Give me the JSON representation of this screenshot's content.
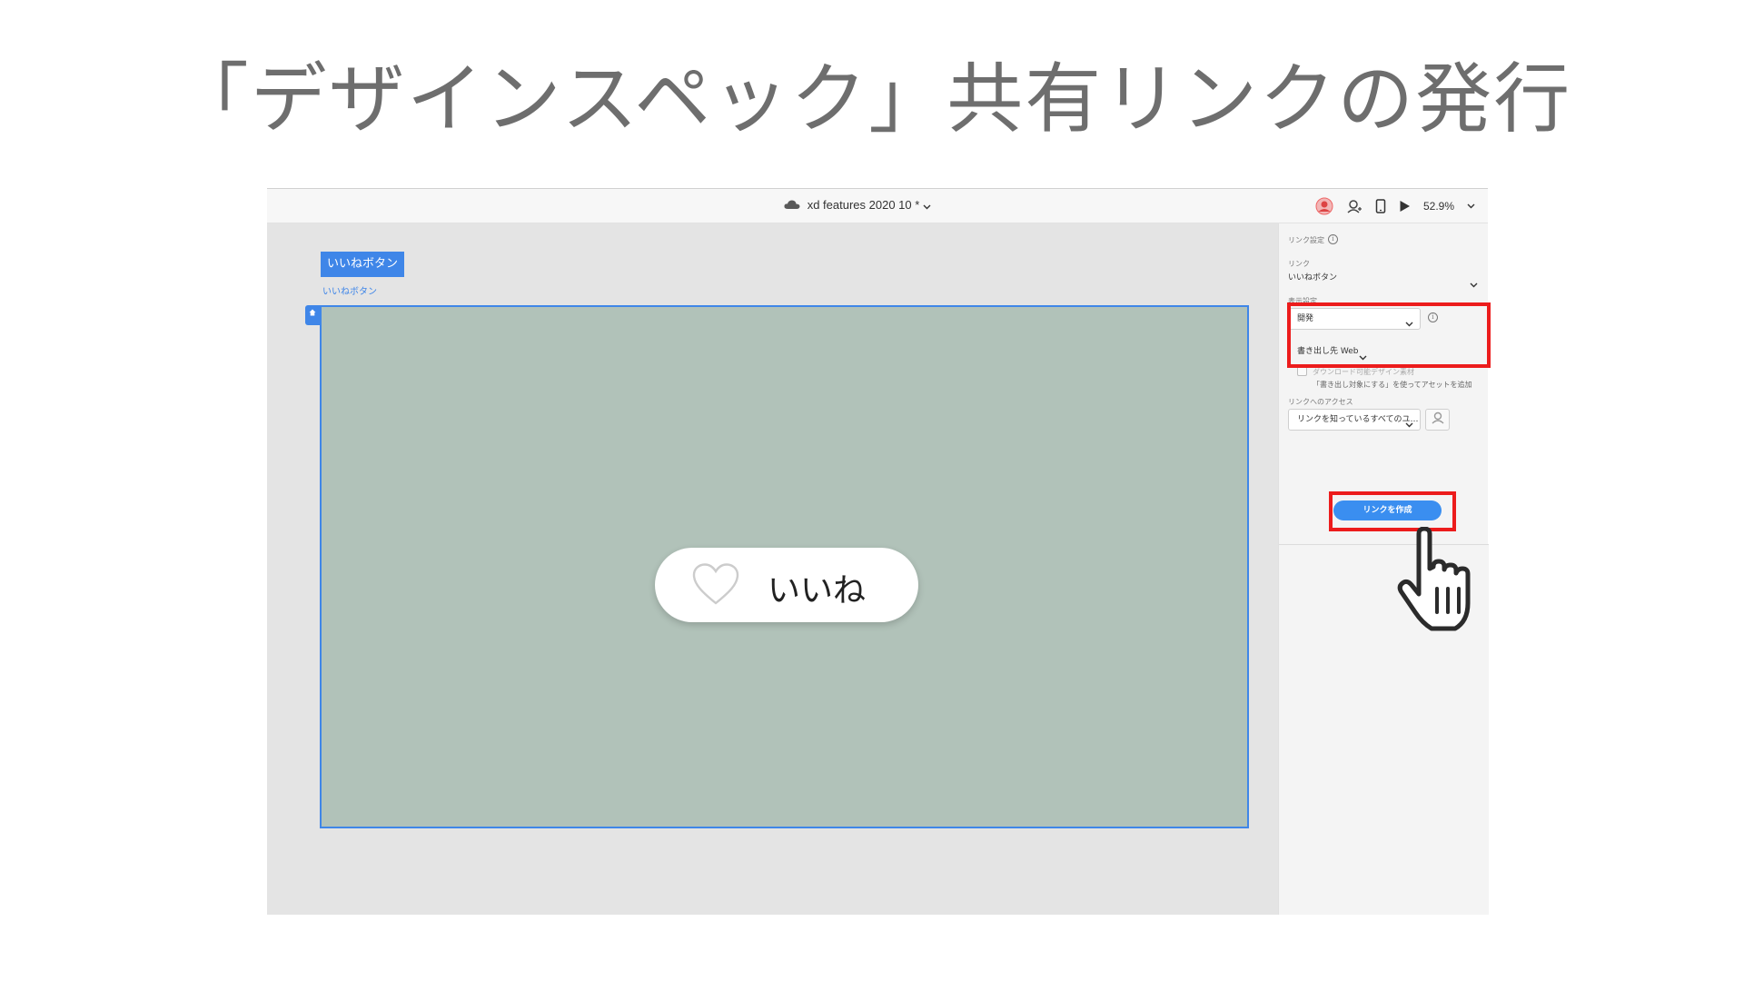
{
  "slide": {
    "title": "「デザインスペック」共有リンクの発行"
  },
  "titlebar": {
    "doc_title": "xd features 2020 10 *",
    "zoom": "52.9%"
  },
  "canvas": {
    "artboard_tag": "いいねボタン",
    "artboard_name": "いいねボタン",
    "like_button_label": "いいね",
    "artboard_color": "#b1c2b9",
    "selection_color": "#3f86e8"
  },
  "panel": {
    "link_settings_label": "リンク設定",
    "link_label": "リンク",
    "link_value": "いいねボタン",
    "view_settings_label": "表示設定",
    "view_settings_value": "開発",
    "export_for_label": "書き出し先",
    "export_for_value": "Web",
    "download_assets_label": "ダウンロード可能デザイン素材",
    "download_assets_hint": "「書き出し対象にする」を使ってアセットを追加",
    "access_label": "リンクへのアクセス",
    "access_value": "リンクを知っているすべてのユ…",
    "create_link_button": "リンクを作成"
  },
  "colors": {
    "highlight": "#ec1c1c",
    "primary_button": "#3a8ef0"
  },
  "icons": {
    "cloud": "cloud-icon",
    "avatar": "user-avatar-icon",
    "invite": "invite-user-icon",
    "device": "mobile-preview-icon",
    "play": "play-icon",
    "home": "home-icon",
    "heart": "heart-icon",
    "info": "info-icon",
    "hand": "pointing-hand-cursor-icon"
  }
}
